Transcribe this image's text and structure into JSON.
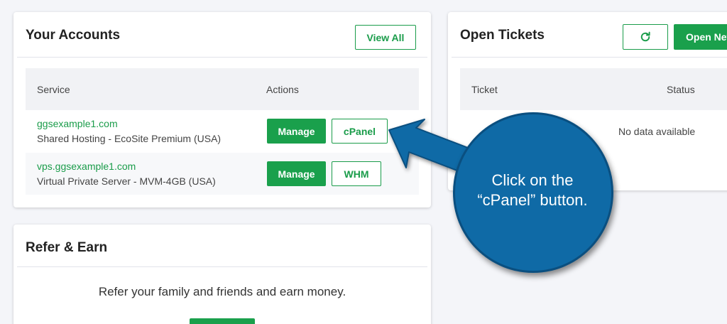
{
  "accounts": {
    "title": "Your Accounts",
    "view_all": "View All",
    "col_service": "Service",
    "col_actions": "Actions",
    "rows": [
      {
        "domain": "ggsexample1.com",
        "plan": "Shared Hosting - EcoSite Premium (USA)",
        "manage": "Manage",
        "panel": "cPanel"
      },
      {
        "domain": "vps.ggsexample1.com",
        "plan": "Virtual Private Server - MVM-4GB (USA)",
        "manage": "Manage",
        "panel": "WHM"
      }
    ]
  },
  "tickets": {
    "title": "Open Tickets",
    "open_new": "Open New",
    "col_ticket": "Ticket",
    "col_status": "Status",
    "empty": "No data available"
  },
  "refer": {
    "title": "Refer & Earn",
    "text": "Refer your family and friends and earn money."
  },
  "callout": {
    "line1": "Click on the",
    "line2": "“cPanel” button."
  },
  "colors": {
    "accent_green": "#1aa04c",
    "callout_blue": "#0f6aa6"
  }
}
